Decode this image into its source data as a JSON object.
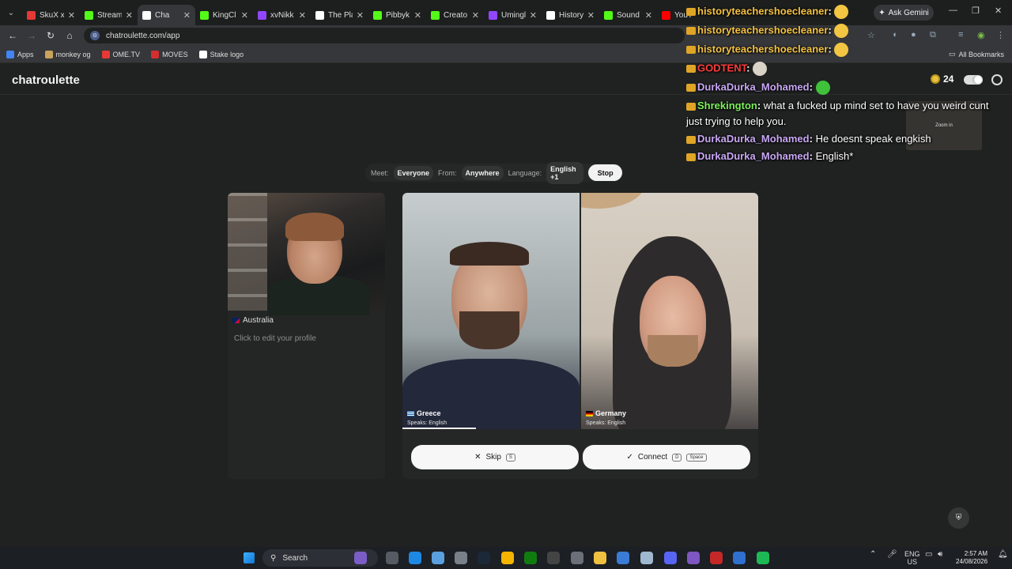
{
  "browser": {
    "tabs": [
      {
        "title": "SkuX x",
        "color": "#e53935"
      },
      {
        "title": "Stream",
        "color": "#53fc18"
      },
      {
        "title": "Cha",
        "color": "#ffffff",
        "active": true
      },
      {
        "title": "KingCl",
        "color": "#53fc18"
      },
      {
        "title": "xvNikk",
        "color": "#9146ff"
      },
      {
        "title": "The Pla",
        "color": "#ffffff"
      },
      {
        "title": "Pibbyk",
        "color": "#53fc18"
      },
      {
        "title": "Creato",
        "color": "#53fc18"
      },
      {
        "title": "Umingl",
        "color": "#9146ff"
      },
      {
        "title": "History",
        "color": "#ffffff"
      },
      {
        "title": "Sound",
        "color": "#53fc18"
      },
      {
        "title": "YouT",
        "color": "#ff0000"
      }
    ],
    "ask_gemini": "Ask Gemini",
    "url": "chatroulette.com/app",
    "bookmarks": [
      {
        "label": "Apps",
        "color": "#4285f4"
      },
      {
        "label": "monkey og",
        "color": "#c9a35a"
      },
      {
        "label": "OME.TV",
        "color": "#e53935"
      },
      {
        "label": "MOVES",
        "color": "#d32f2f"
      },
      {
        "label": "Stake logo",
        "color": "#ffffff"
      }
    ],
    "all_bookmarks": "All Bookmarks"
  },
  "app": {
    "brand": "chatroulette",
    "coins": "24",
    "filter": {
      "meet_label": "Meet:",
      "meet_value": "Everyone",
      "from_label": "From:",
      "from_value": "Anywhere",
      "language_label": "Language:",
      "language_value": "English +1",
      "stop": "Stop"
    },
    "self": {
      "country": "Australia",
      "edit_prompt": "Click to edit your profile"
    },
    "remotes": [
      {
        "country": "Greece",
        "speaks": "Speaks: English"
      },
      {
        "country": "Germany",
        "speaks": "Speaks: English"
      }
    ],
    "skip_label": "Skip",
    "skip_key": "S",
    "connect_label": "Connect",
    "connect_key1": "D",
    "connect_key2": "Space"
  },
  "chat": {
    "messages": [
      {
        "user": "historyteachershoecleaner",
        "text": "",
        "color": "#f5c242"
      },
      {
        "user": "historyteachershoecleaner",
        "text": "",
        "color": "#f5c242"
      },
      {
        "user": "historyteachershoecleaner",
        "text": "",
        "color": "#f5c242"
      },
      {
        "user": "GODTENT",
        "text": "",
        "color": "#ff3b3b"
      },
      {
        "user": "DurkaDurka_Mohamed",
        "text": "",
        "color": "#c9a7f5"
      },
      {
        "user": "Shrekington",
        "text": "what a fucked up mind set to have you weird cunt",
        "color": "#7cf05a"
      },
      {
        "user": "",
        "text": "just trying to help you.",
        "color": "#ffffff"
      },
      {
        "user": "DurkaDurka_Mohamed",
        "text": "He doesnt speak engkish",
        "color": "#c9a7f5"
      },
      {
        "user": "DurkaDurka_Mohamed",
        "text": "English*",
        "color": "#c9a7f5"
      }
    ],
    "zoom_in": "Zoom in"
  },
  "taskbar": {
    "search": "Search",
    "lang1": "ENG",
    "lang2": "US",
    "time": "2:57 AM",
    "date": "24/08/2026"
  }
}
